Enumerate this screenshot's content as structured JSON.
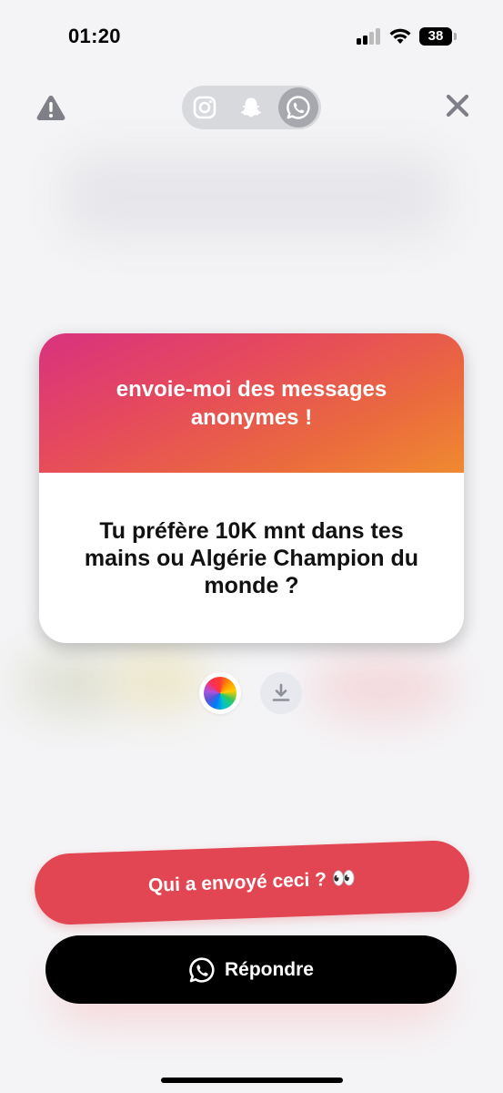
{
  "status_bar": {
    "time": "01:20",
    "battery": "38"
  },
  "platforms": [
    {
      "name": "instagram",
      "icon": "instagram-icon"
    },
    {
      "name": "snapchat",
      "icon": "snapchat-icon"
    },
    {
      "name": "whatsapp",
      "icon": "whatsapp-icon",
      "selected": true
    }
  ],
  "card": {
    "header": "envoie-moi des messages anonymes !",
    "question": "Tu préfère 10K mnt dans tes mains ou Algérie Champion du monde ?"
  },
  "actions": {
    "who_sent": "Qui a envoyé ceci ? 👀",
    "reply": "Répondre"
  },
  "colors": {
    "accent_red": "#e24652",
    "reply_bg": "#000000",
    "gradient": [
      "#d8327f",
      "#e64a5c",
      "#f08a30"
    ]
  }
}
